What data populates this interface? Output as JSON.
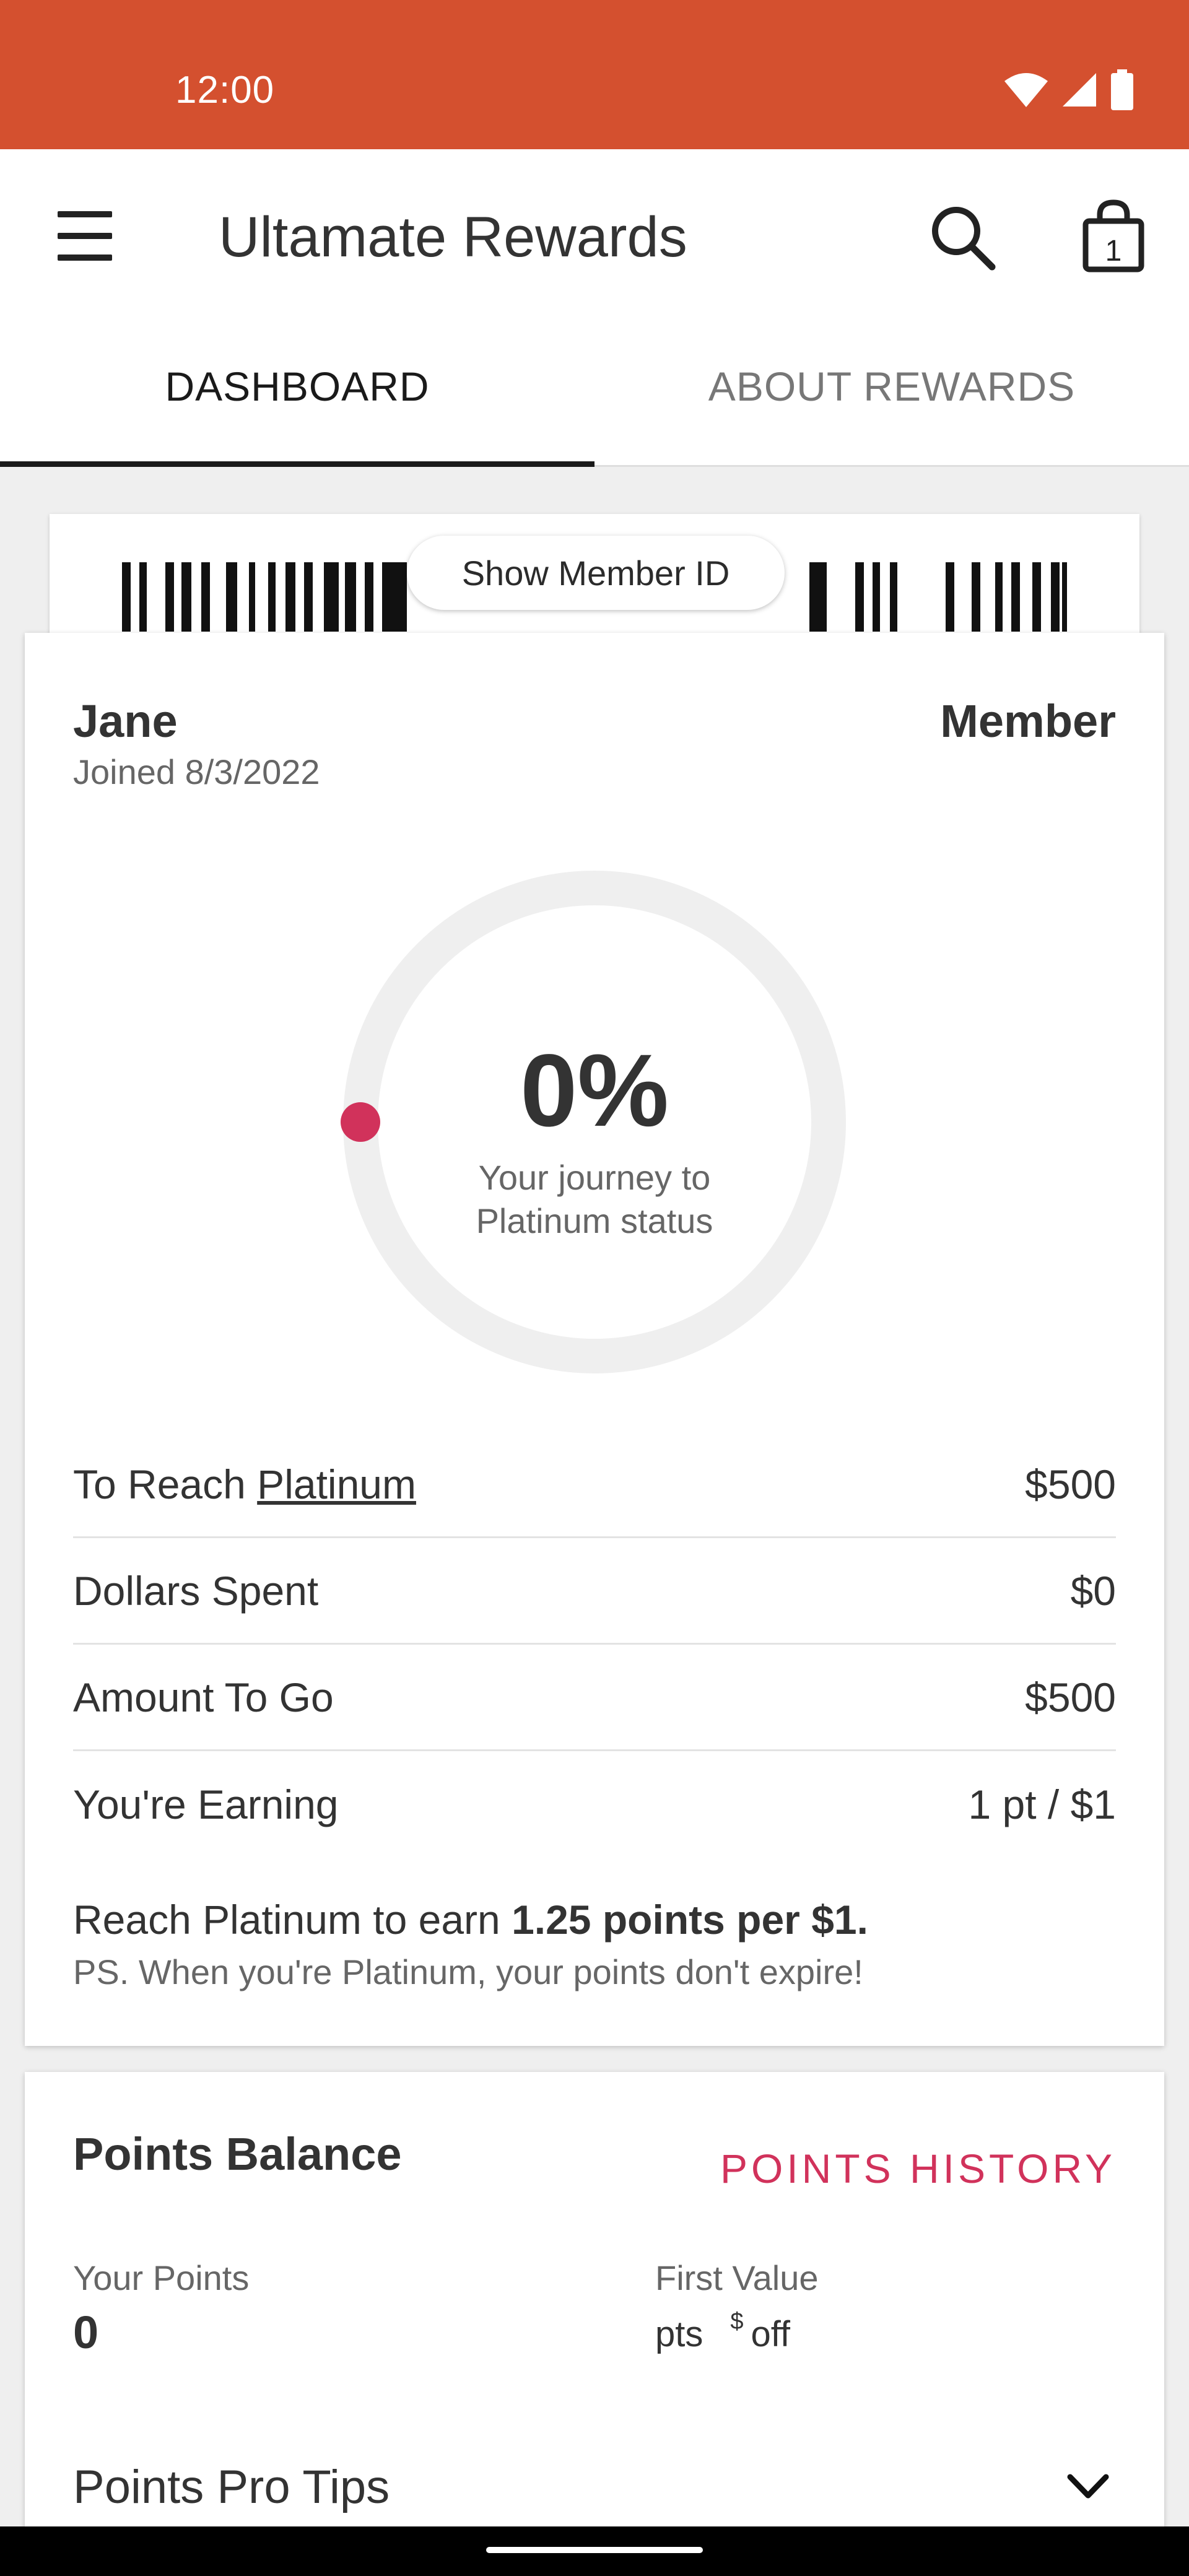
{
  "status_bar": {
    "time": "12:00",
    "color": "#d4502f"
  },
  "header": {
    "title": "Ultamate Rewards",
    "menu_icon": "hamburger-menu-icon",
    "search_icon": "search-icon",
    "bag_icon": "shopping-bag-icon",
    "bag_count": "1"
  },
  "tabs": [
    {
      "label": "DASHBOARD",
      "active": true
    },
    {
      "label": "ABOUT REWARDS",
      "active": false
    }
  ],
  "member_id": {
    "button_label": "Show Member ID"
  },
  "member": {
    "name": "Jane",
    "tier": "Member",
    "joined": "Joined 8/3/2022"
  },
  "progress": {
    "percent_label": "0%",
    "percent_value": 0,
    "caption_line1": "Your journey to",
    "caption_line2": "Platinum status",
    "accent_color": "#d1325b"
  },
  "stats": {
    "reach_prefix": "To Reach ",
    "reach_link": "Platinum",
    "reach_value": "$500",
    "spent_label": "Dollars Spent",
    "spent_value": "$0",
    "to_go_label": "Amount To Go",
    "to_go_value": "$500",
    "earning_label": "You're Earning",
    "earning_value": "1 pt / $1"
  },
  "earn_note": {
    "prefix": "Reach Platinum to earn ",
    "bold": "1.25 points per $1.",
    "sub": "PS. When you're Platinum, your points don't expire!"
  },
  "points": {
    "title": "Points Balance",
    "history_link": "POINTS HISTORY",
    "your_points_label": "Your Points",
    "your_points_value": "0",
    "first_value_label": "First Value",
    "first_value_pts": "pts",
    "first_value_dollar": "$",
    "first_value_off": "off",
    "pro_tips_label": "Points Pro Tips",
    "accent_color": "#d1325b"
  }
}
